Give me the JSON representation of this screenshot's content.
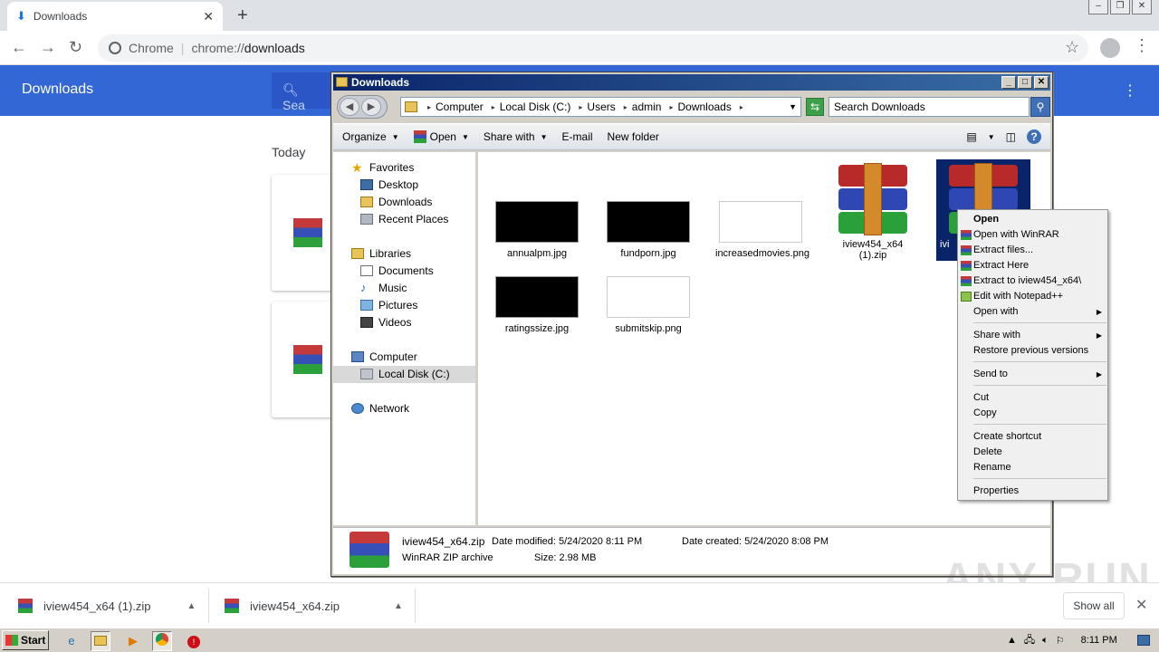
{
  "browser": {
    "tab_title": "Downloads",
    "omnibox_site": "Chrome",
    "omnibox_url_scheme": "chrome://",
    "omnibox_url_path": "downloads"
  },
  "downloads_page": {
    "header_title": "Downloads",
    "search_placeholder": "Sea",
    "section_today": "Today"
  },
  "explorer": {
    "title": "Downloads",
    "breadcrumb": [
      "Computer",
      "Local Disk (C:)",
      "Users",
      "admin",
      "Downloads"
    ],
    "search_placeholder": "Search Downloads",
    "toolbar": {
      "organize": "Organize",
      "open": "Open",
      "share_with": "Share with",
      "email": "E-mail",
      "new_folder": "New folder"
    },
    "nav": {
      "favorites": "Favorites",
      "desktop": "Desktop",
      "downloads": "Downloads",
      "recent_places": "Recent Places",
      "libraries": "Libraries",
      "documents": "Documents",
      "music": "Music",
      "pictures": "Pictures",
      "videos": "Videos",
      "computer": "Computer",
      "local_disk": "Local Disk (C:)",
      "network": "Network"
    },
    "files": {
      "f1": "annualpm.jpg",
      "f2": "fundporn.jpg",
      "f3": "increasedmovies.png",
      "f4": "iview454_x64 (1).zip",
      "f5": "ivi",
      "f6": "ratingssize.jpg",
      "f7": "submitskip.png"
    },
    "details": {
      "name": "iview454_x64.zip",
      "type": "WinRAR ZIP archive",
      "modified": "Date modified: 5/24/2020 8:11 PM",
      "size": "Size: 2.98 MB",
      "created": "Date created: 5/24/2020 8:08 PM"
    }
  },
  "context_menu": {
    "open": "Open",
    "open_winrar": "Open with WinRAR",
    "extract_files": "Extract files...",
    "extract_here": "Extract Here",
    "extract_to": "Extract to iview454_x64\\",
    "edit_npp": "Edit with Notepad++",
    "open_with": "Open with",
    "share_with": "Share with",
    "restore": "Restore previous versions",
    "send_to": "Send to",
    "cut": "Cut",
    "copy": "Copy",
    "create_shortcut": "Create shortcut",
    "delete": "Delete",
    "rename": "Rename",
    "properties": "Properties"
  },
  "shelf": {
    "item1": "iview454_x64 (1).zip",
    "item2": "iview454_x64.zip",
    "show_all": "Show all"
  },
  "taskbar": {
    "start": "Start",
    "clock": "8:11 PM"
  },
  "watermark": "ANY RUN"
}
